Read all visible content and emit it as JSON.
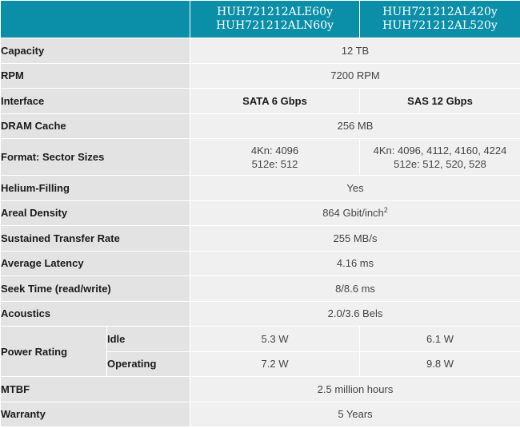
{
  "header": {
    "col_a": [
      "HUH721212ALE60y",
      "HUH721212ALN60y"
    ],
    "col_b": [
      "HUH721212AL420y",
      "HUH721212AL520y"
    ]
  },
  "rows": {
    "capacity": {
      "label": "Capacity",
      "value": "12 TB"
    },
    "rpm": {
      "label": "RPM",
      "value": "7200 RPM"
    },
    "interface": {
      "label": "Interface",
      "a": "SATA 6 Gbps",
      "b": "SAS 12 Gbps"
    },
    "dram": {
      "label": "DRAM Cache",
      "value": "256 MB"
    },
    "format": {
      "label": "Format: Sector Sizes",
      "a": [
        "4Kn: 4096",
        "512e: 512"
      ],
      "b": [
        "4Kn: 4096, 4112, 4160, 4224",
        "512e: 512, 520, 528"
      ]
    },
    "helium": {
      "label": "Helium-Filling",
      "value": "Yes"
    },
    "areal": {
      "label": "Areal Density",
      "value": "864 Gbit/inch",
      "sup": "2"
    },
    "transfer": {
      "label": "Sustained Transfer Rate",
      "value": "255 MB/s"
    },
    "latency": {
      "label": "Average Latency",
      "value": "4.16 ms"
    },
    "seek": {
      "label": "Seek Time (read/write)",
      "value": "8/8.6 ms"
    },
    "acoustics": {
      "label": "Acoustics",
      "value": "2.0/3.6 Bels"
    },
    "power": {
      "label": "Power Rating",
      "idle": {
        "label": "Idle",
        "a": "5.3 W",
        "b": "6.1 W"
      },
      "operating": {
        "label": "Operating",
        "a": "7.2 W",
        "b": "9.8 W"
      }
    },
    "mtbf": {
      "label": "MTBF",
      "value": "2.5 million hours"
    },
    "warranty": {
      "label": "Warranty",
      "value": "5 Years"
    }
  }
}
